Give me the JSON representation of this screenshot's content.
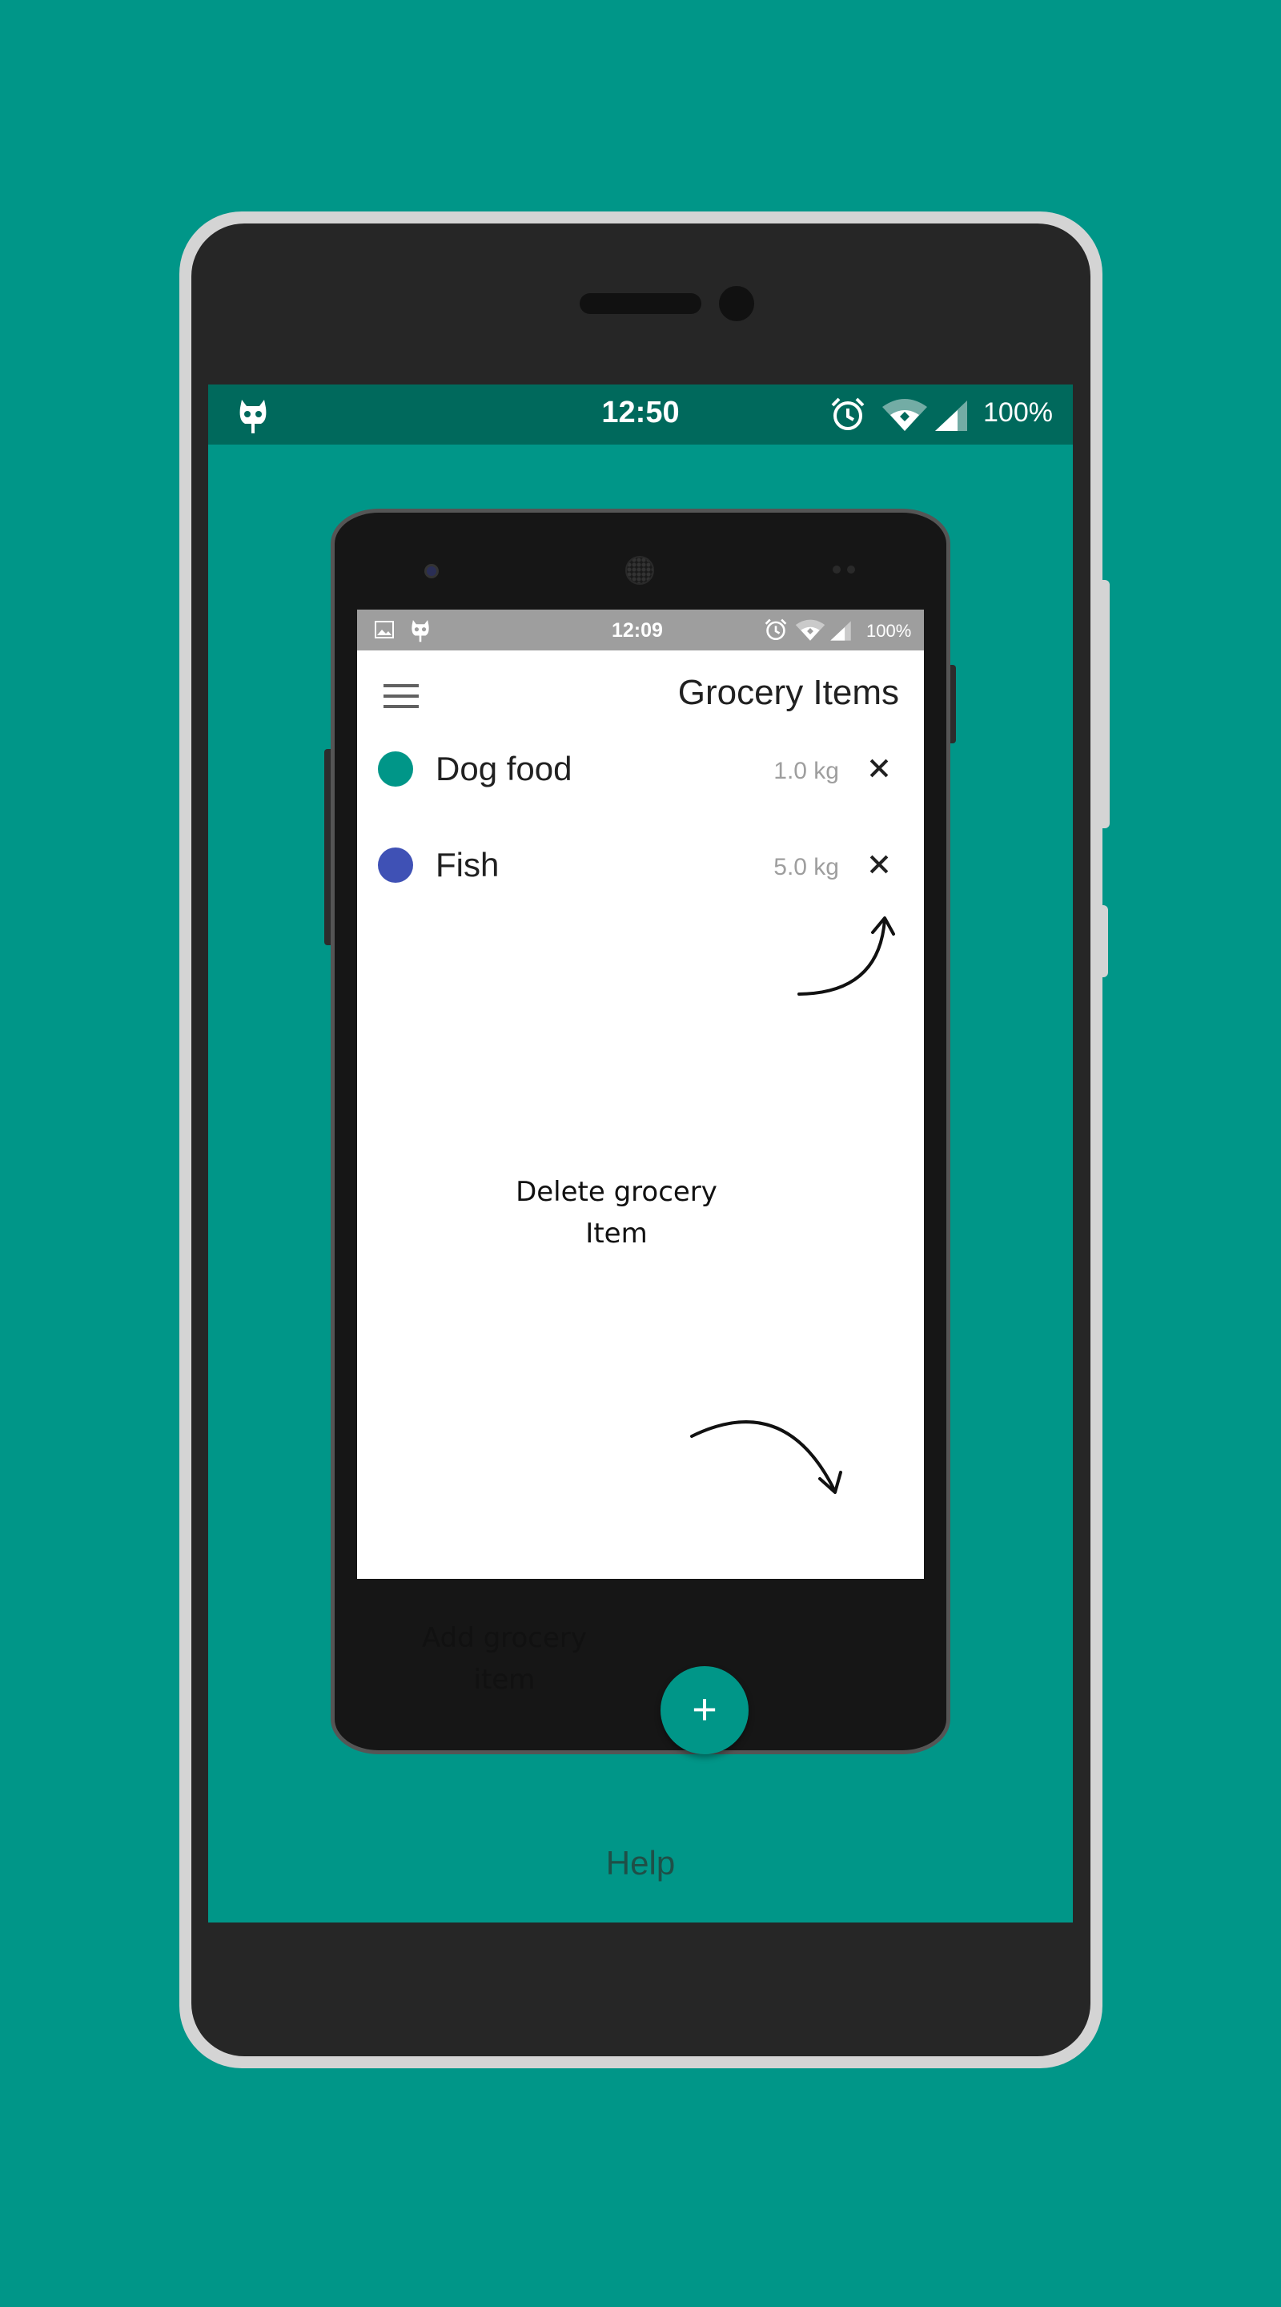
{
  "outer_status": {
    "time": "12:50",
    "battery": "100%",
    "icons": [
      "cyanogenmod-icon",
      "alarm-icon",
      "wifi-icon",
      "signal-icon"
    ]
  },
  "inner_status": {
    "time": "12:09",
    "battery": "100%",
    "icons": [
      "image-icon",
      "cyanogenmod-icon",
      "alarm-icon",
      "wifi-icon",
      "signal-icon"
    ]
  },
  "app": {
    "title": "Grocery Items",
    "items": [
      {
        "name": "Dog food",
        "quantity": "1.0 kg",
        "color": "#009688"
      },
      {
        "name": "Fish",
        "quantity": "5.0 kg",
        "color": "#3f51b5"
      }
    ],
    "fab_label": "+"
  },
  "annotations": {
    "delete_line1": "Delete grocery",
    "delete_line2": "Item",
    "add_line1": "Add grocery",
    "add_line2": "item"
  },
  "help_label": "Help",
  "colors": {
    "background": "#009688",
    "status_bar": "#00695c",
    "accent": "#009688"
  }
}
